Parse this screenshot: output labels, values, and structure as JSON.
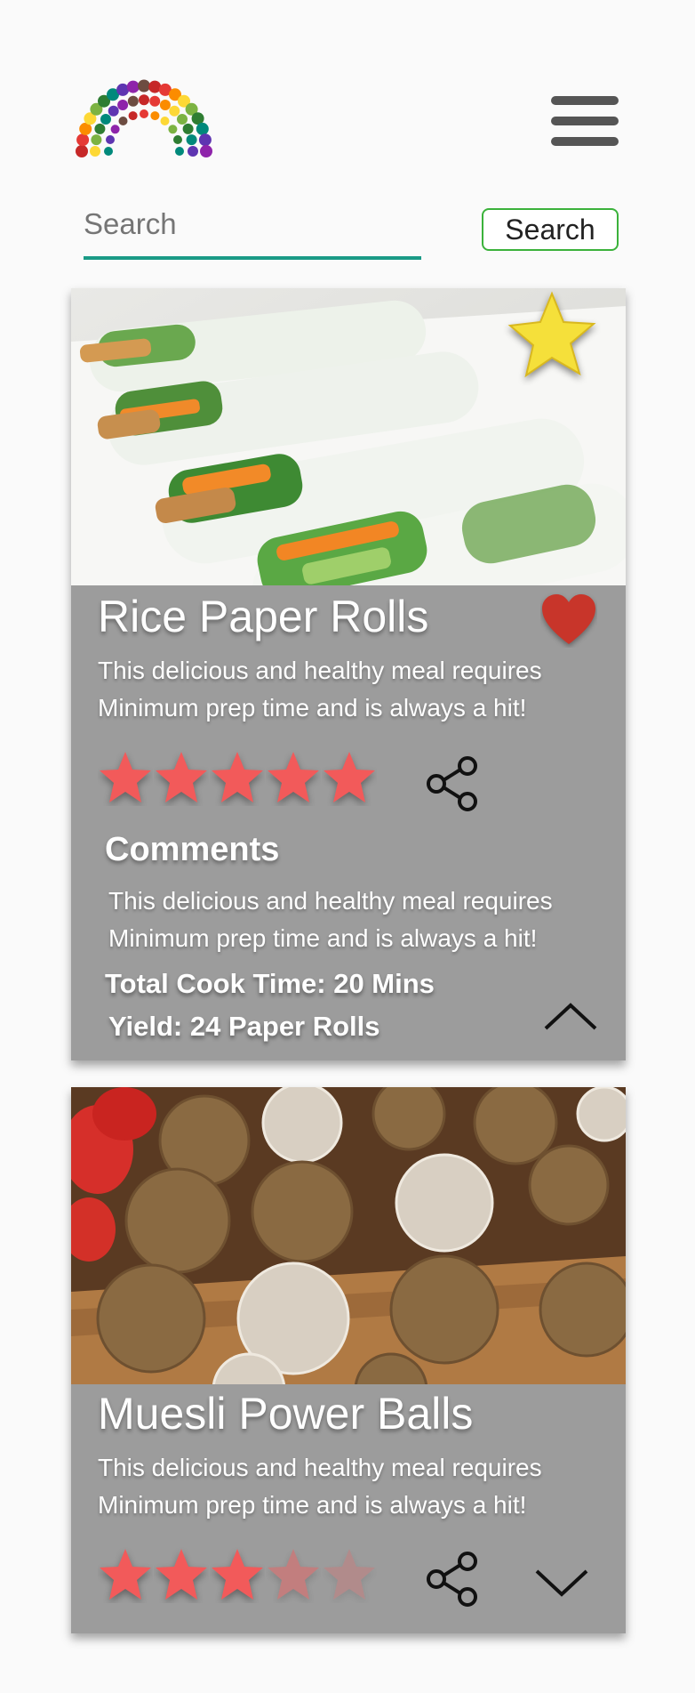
{
  "header": {
    "logo_icon": "fruit-vegetable-rainbow-logo",
    "menu_icon": "hamburger-menu-icon"
  },
  "search": {
    "placeholder": "Search",
    "value": "Search",
    "button_label": "Search"
  },
  "colors": {
    "accent": "#1a9a86",
    "button_border": "#3bb23b",
    "card_bg": "#9c9c9c",
    "rating_star": "#f25a5a",
    "heart": "#c8352a",
    "favorite_star": "#f5e03a"
  },
  "recipes": [
    {
      "title": "Rice Paper Rolls",
      "image_icon": "rice-paper-rolls-photo",
      "favorite_icon": "favorite-star-icon",
      "like_icon": "heart-icon",
      "description_line1": "This delicious and healthy meal requires",
      "description_line2": "Minimum prep time and is always a hit!",
      "rating": 5,
      "rating_max": 5,
      "share_icon": "share-icon",
      "comments_heading": "Comments",
      "comments_line1": "This delicious and healthy meal requires",
      "comments_line2": "Minimum prep time and is always a hit!",
      "cook_time": "Total Cook Time: 20 Mins",
      "yield": "Yield: 24 Paper Rolls",
      "toggle_icon": "chevron-up-icon",
      "expanded": true
    },
    {
      "title": "Muesli Power Balls",
      "image_icon": "muesli-power-balls-photo",
      "description_line1": "This delicious and healthy meal requires",
      "description_line2": "Minimum prep time and is always a hit!",
      "rating": 3,
      "rating_max": 5,
      "share_icon": "share-icon",
      "toggle_icon": "chevron-down-icon",
      "expanded": false
    }
  ]
}
